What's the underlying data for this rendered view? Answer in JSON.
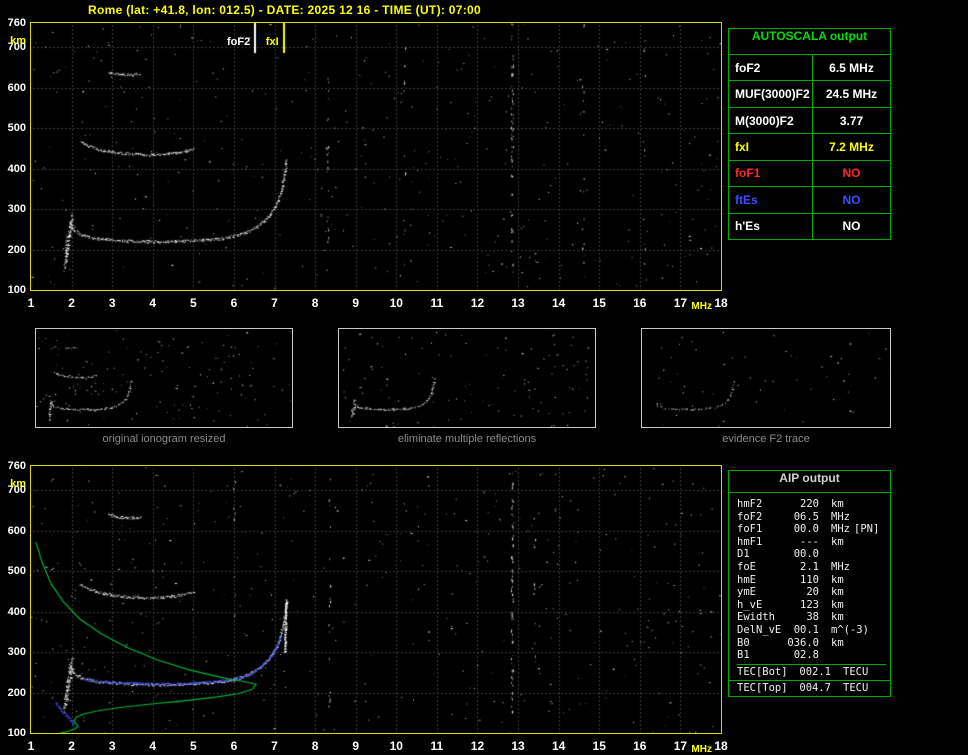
{
  "title": "Rome (lat: +41.8, lon: 012.5) - DATE: 2025 12 16 - TIME (UT): 07:00",
  "axes": {
    "y_ticks": [
      "760",
      "700",
      "600",
      "500",
      "400",
      "300",
      "200",
      "100"
    ],
    "y_unit": "km",
    "x_ticks": [
      "1",
      "2",
      "3",
      "4",
      "5",
      "6",
      "7",
      "8",
      "9",
      "10",
      "11",
      "12",
      "13",
      "14",
      "15",
      "16",
      "17",
      "18"
    ],
    "x_unit": "MHz"
  },
  "markers": {
    "foF2_label": "foF2",
    "fxI_label": "fxI",
    "foF2_mhz": 6.5,
    "fxI_mhz": 7.2
  },
  "autoscala": {
    "title": "AUTOSCALA output",
    "rows": [
      {
        "label": "foF2",
        "value": "6.5 MHz",
        "color": "white"
      },
      {
        "label": "MUF(3000)F2",
        "value": "24.5 MHz",
        "color": "white"
      },
      {
        "label": "M(3000)F2",
        "value": "3.77",
        "color": "white"
      },
      {
        "label": "fxI",
        "value": "7.2 MHz",
        "color": "yellow"
      },
      {
        "label": "foF1",
        "value": "NO",
        "color": "red"
      },
      {
        "label": "ftEs",
        "value": "NO",
        "color": "blue"
      },
      {
        "label": "h'Es",
        "value": "NO",
        "color": "white"
      }
    ]
  },
  "thumbnails": [
    {
      "caption": "original ionogram resized"
    },
    {
      "caption": "eliminate multiple reflections"
    },
    {
      "caption": "evidence F2 trace"
    }
  ],
  "aip": {
    "title": "AIP output",
    "rows": [
      {
        "label": "hmF2",
        "value": "220",
        "unit": "km",
        "note": ""
      },
      {
        "label": "foF2",
        "value": "06.5",
        "unit": "MHz",
        "note": ""
      },
      {
        "label": "foF1",
        "value": "00.0",
        "unit": "MHz",
        "note": "[PN]"
      },
      {
        "label": "hmF1",
        "value": "---",
        "unit": "km",
        "note": ""
      },
      {
        "label": "D1",
        "value": "00.0",
        "unit": "",
        "note": ""
      },
      {
        "label": "foE",
        "value": "2.1",
        "unit": "MHz",
        "note": ""
      },
      {
        "label": "hmE",
        "value": "110",
        "unit": "km",
        "note": ""
      },
      {
        "label": "ymE",
        "value": "20",
        "unit": "km",
        "note": ""
      },
      {
        "label": "h_vE",
        "value": "123",
        "unit": "km",
        "note": ""
      },
      {
        "label": "Ewidth",
        "value": "38",
        "unit": "km",
        "note": ""
      },
      {
        "label": "DelN_vE",
        "value": "00.1",
        "unit": "m^(-3)",
        "note": ""
      },
      {
        "label": "B0",
        "value": "036.0",
        "unit": "km",
        "note": ""
      },
      {
        "label": "B1",
        "value": "02.8",
        "unit": "",
        "note": ""
      }
    ],
    "tec_rows": [
      {
        "label": "TEC[Bot]",
        "value": "002.1",
        "unit": "TECU"
      },
      {
        "label": "TEC[Top]",
        "value": "004.7",
        "unit": "TECU"
      }
    ]
  },
  "ionogram": {
    "x_range_mhz": [
      1,
      18
    ],
    "y_range_km": [
      100,
      760
    ],
    "trace_sets": {
      "main": [
        [
          1.95,
          270
        ],
        [
          2.05,
          248
        ],
        [
          2.25,
          236
        ],
        [
          2.6,
          228
        ],
        [
          3.0,
          224
        ],
        [
          3.5,
          221
        ],
        [
          4.1,
          220
        ],
        [
          4.7,
          221
        ],
        [
          5.2,
          224
        ],
        [
          5.7,
          228
        ],
        [
          6.05,
          235
        ],
        [
          6.35,
          245
        ],
        [
          6.6,
          260
        ],
        [
          6.85,
          283
        ],
        [
          7.05,
          313
        ],
        [
          7.17,
          350
        ],
        [
          7.24,
          388
        ],
        [
          7.29,
          425
        ]
      ],
      "hop2": [
        [
          2.2,
          468
        ],
        [
          2.45,
          455
        ],
        [
          2.75,
          446
        ],
        [
          3.1,
          440
        ],
        [
          3.5,
          436
        ],
        [
          3.95,
          435
        ],
        [
          4.35,
          437
        ],
        [
          4.7,
          442
        ],
        [
          5.0,
          450
        ]
      ],
      "hop3": [
        [
          2.9,
          640
        ],
        [
          3.15,
          634
        ],
        [
          3.45,
          632
        ],
        [
          3.7,
          635
        ]
      ],
      "lowclutter": [
        [
          1.82,
          160
        ],
        [
          1.87,
          200
        ],
        [
          1.92,
          235
        ],
        [
          1.97,
          262
        ],
        [
          2.0,
          278
        ]
      ],
      "asym": [
        [
          7.24,
          300
        ],
        [
          7.28,
          430
        ]
      ],
      "blue_fit": [
        [
          2.3,
          232
        ],
        [
          3.0,
          226
        ],
        [
          3.8,
          222
        ],
        [
          4.6,
          222
        ],
        [
          5.3,
          226
        ],
        [
          5.9,
          232
        ],
        [
          6.3,
          242
        ],
        [
          6.6,
          258
        ],
        [
          6.85,
          282
        ],
        [
          7.05,
          315
        ],
        [
          7.15,
          345
        ]
      ],
      "blue_e": [
        [
          1.6,
          175
        ],
        [
          1.75,
          155
        ],
        [
          1.9,
          140
        ],
        [
          2.0,
          130
        ],
        [
          2.05,
          118
        ]
      ],
      "green_profile": [
        [
          1.12,
          572
        ],
        [
          1.28,
          520
        ],
        [
          1.5,
          468
        ],
        [
          1.8,
          424
        ],
        [
          2.2,
          382
        ],
        [
          2.75,
          344
        ],
        [
          3.4,
          310
        ],
        [
          4.1,
          281
        ],
        [
          4.9,
          256
        ],
        [
          5.7,
          237
        ],
        [
          6.3,
          226
        ],
        [
          6.55,
          220
        ],
        [
          6.45,
          208
        ],
        [
          6.1,
          197
        ],
        [
          5.5,
          188
        ],
        [
          4.7,
          179
        ],
        [
          3.9,
          171
        ],
        [
          3.2,
          163
        ],
        [
          2.65,
          155
        ],
        [
          2.3,
          147
        ],
        [
          2.12,
          139
        ],
        [
          2.06,
          131
        ],
        [
          2.1,
          124
        ],
        [
          2.16,
          117
        ],
        [
          2.1,
          111
        ],
        [
          1.95,
          105
        ],
        [
          1.7,
          99
        ],
        [
          1.4,
          94
        ],
        [
          1.15,
          90
        ]
      ]
    },
    "plots": [
      {
        "canvas": "top-canvas",
        "grid": true,
        "seed": 7,
        "noise": 420,
        "streaks": [
          [
            12.85,
            55
          ],
          [
            8.3,
            18
          ],
          [
            14.6,
            14
          ],
          [
            10.2,
            10
          ],
          [
            16.1,
            8
          ]
        ],
        "traces": [
          {
            "set": "main"
          },
          {
            "set": "hop2"
          },
          {
            "set": "hop3"
          },
          {
            "set": "lowclutter",
            "jx": 3,
            "jy": 12,
            "density": 2.2
          }
        ],
        "mk": [
          {
            "mhz": 6.5,
            "color": "#ffffff",
            "len": 30
          },
          {
            "mhz": 7.2,
            "color": "#ffff00",
            "len": 30
          }
        ]
      },
      {
        "canvas": "bottom-canvas",
        "grid": true,
        "seed": 13,
        "noise": 430,
        "streaks": [
          [
            12.85,
            65
          ],
          [
            8.35,
            16
          ],
          [
            13.4,
            12
          ],
          [
            6.0,
            8
          ]
        ],
        "traces": [
          {
            "set": "main"
          },
          {
            "set": "hop2"
          },
          {
            "set": "hop3"
          },
          {
            "set": "lowclutter",
            "jx": 3,
            "jy": 12,
            "density": 2.2
          },
          {
            "set": "asym",
            "density": 2.5
          },
          {
            "set": "blue_fit",
            "color": "#4455ff",
            "jy": 2.4,
            "density": 1.8
          },
          {
            "set": "blue_e",
            "color": "#4455ff",
            "jy": 2.4,
            "density": 1.8
          }
        ],
        "lines": [
          {
            "set": "green_profile",
            "color": "#00b43c"
          }
        ]
      },
      {
        "canvas": "thumb1-canvas",
        "grid": false,
        "seed": 21,
        "noise": 150,
        "traces": [
          {
            "set": "main",
            "density": 0.8,
            "jy": 1.6
          },
          {
            "set": "hop2",
            "density": 0.7,
            "jy": 1.6
          },
          {
            "set": "hop3",
            "density": 0.6,
            "jy": 1.4
          },
          {
            "set": "lowclutter",
            "jx": 2,
            "jy": 6,
            "density": 1.4
          }
        ]
      },
      {
        "canvas": "thumb2-canvas",
        "grid": false,
        "seed": 33,
        "noise": 110,
        "traces": [
          {
            "set": "main",
            "density": 0.8,
            "jy": 1.6
          },
          {
            "set": "lowclutter",
            "jx": 2,
            "jy": 6,
            "density": 1.2
          }
        ]
      },
      {
        "canvas": "thumb3-canvas",
        "grid": false,
        "seed": 44,
        "noise": 55,
        "traces": [
          {
            "set": "main",
            "density": 0.45,
            "jy": 1.4
          }
        ]
      }
    ]
  }
}
